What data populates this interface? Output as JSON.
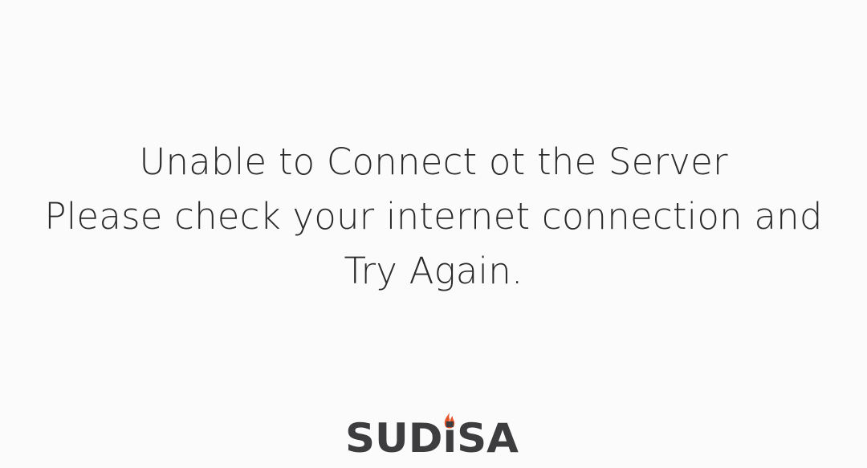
{
  "error": {
    "line1": "Unable to Connect ot the Server",
    "line2": "Please check your internet connection and",
    "line3": "Try Again."
  },
  "logo": {
    "text": "SUDiSA",
    "icon": "flame-icon",
    "text_color": "#3d3d3f",
    "flame_color": "#e8552a"
  }
}
